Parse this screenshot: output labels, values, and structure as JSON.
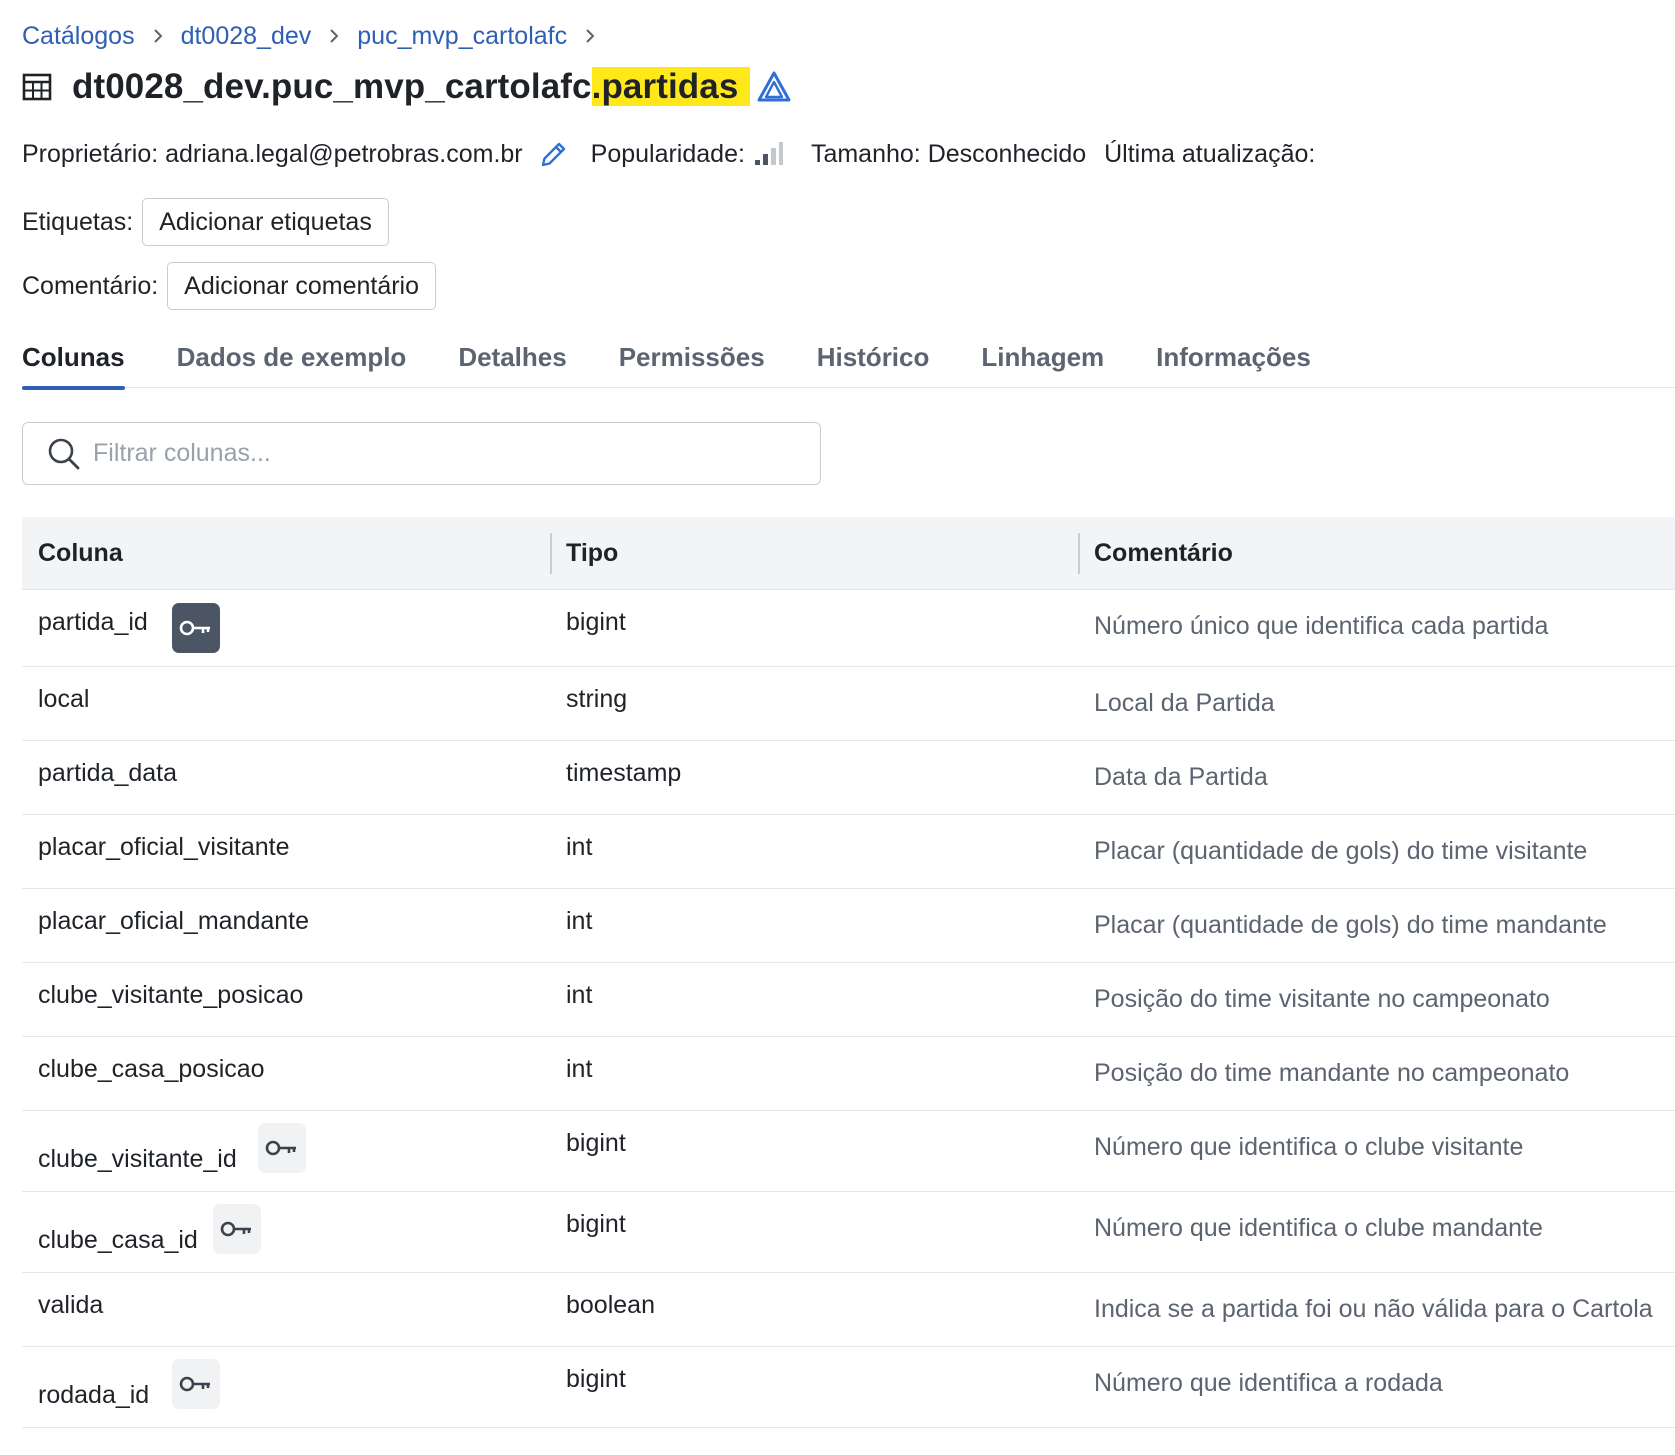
{
  "breadcrumb": {
    "items": [
      "Catálogos",
      "dt0028_dev",
      "puc_mvp_cartolafc"
    ]
  },
  "title": {
    "prefix": "dt0028_dev.puc_mvp_cartolafc",
    "highlight": ".partidas",
    "highlight_color": "#ffe81a"
  },
  "meta": {
    "owner_label": "Proprietário:",
    "owner_value": "adriana.legal@petrobras.com.br",
    "popularity_label": "Popularidade:",
    "size_label": "Tamanho:",
    "size_value": "Desconhecido",
    "updated_label": "Última atualização:"
  },
  "tags": {
    "label": "Etiquetas:",
    "button": "Adicionar etiquetas"
  },
  "comment": {
    "label": "Comentário:",
    "button": "Adicionar comentário"
  },
  "tabs": [
    {
      "label": "Colunas",
      "active": true
    },
    {
      "label": "Dados de exemplo",
      "active": false
    },
    {
      "label": "Detalhes",
      "active": false
    },
    {
      "label": "Permissões",
      "active": false
    },
    {
      "label": "Histórico",
      "active": false
    },
    {
      "label": "Linhagem",
      "active": false
    },
    {
      "label": "Informações",
      "active": false
    }
  ],
  "search": {
    "placeholder": "Filtrar colunas..."
  },
  "columns_table": {
    "headers": [
      "Coluna",
      "Tipo",
      "Comentário"
    ],
    "rows": [
      {
        "name": "partida_id",
        "type": "bigint",
        "comment": "Número único que identifica cada partida",
        "key": "primary"
      },
      {
        "name": "local",
        "type": "string",
        "comment": "Local da Partida",
        "key": ""
      },
      {
        "name": "partida_data",
        "type": "timestamp",
        "comment": "Data da Partida",
        "key": ""
      },
      {
        "name": "placar_oficial_visitante",
        "type": "int",
        "comment": "Placar (quantidade de gols) do time visitante",
        "key": ""
      },
      {
        "name": "placar_oficial_mandante",
        "type": "int",
        "comment": "Placar (quantidade de gols) do time mandante",
        "key": ""
      },
      {
        "name": "clube_visitante_posicao",
        "type": "int",
        "comment": "Posição do time visitante no campeonato",
        "key": ""
      },
      {
        "name": "clube_casa_posicao",
        "type": "int",
        "comment": "Posição do time mandante no campeonato",
        "key": ""
      },
      {
        "name": "clube_visitante_id",
        "type": "bigint",
        "comment": "Número que identifica o clube visitante",
        "key": "foreign"
      },
      {
        "name": "clube_casa_id",
        "type": "bigint",
        "comment": "Número que identifica o clube mandante",
        "key": "foreign"
      },
      {
        "name": "valida",
        "type": "boolean",
        "comment": "Indica se a partida foi ou não válida para o Cartola",
        "key": ""
      },
      {
        "name": "rodada_id",
        "type": "bigint",
        "comment": "Número que identifica a rodada",
        "key": "foreign"
      }
    ]
  },
  "colors": {
    "link": "#2f5fb3",
    "primary_key_badge": "#4b5563",
    "foreign_key_badge": "#f1f2f4"
  },
  "icons": {
    "table": "table-icon",
    "delta": "delta-icon",
    "edit": "pencil-icon",
    "popularity": "signal-bars-icon",
    "search": "search-icon",
    "primary_key": "key-icon",
    "foreign_key": "key-icon"
  }
}
